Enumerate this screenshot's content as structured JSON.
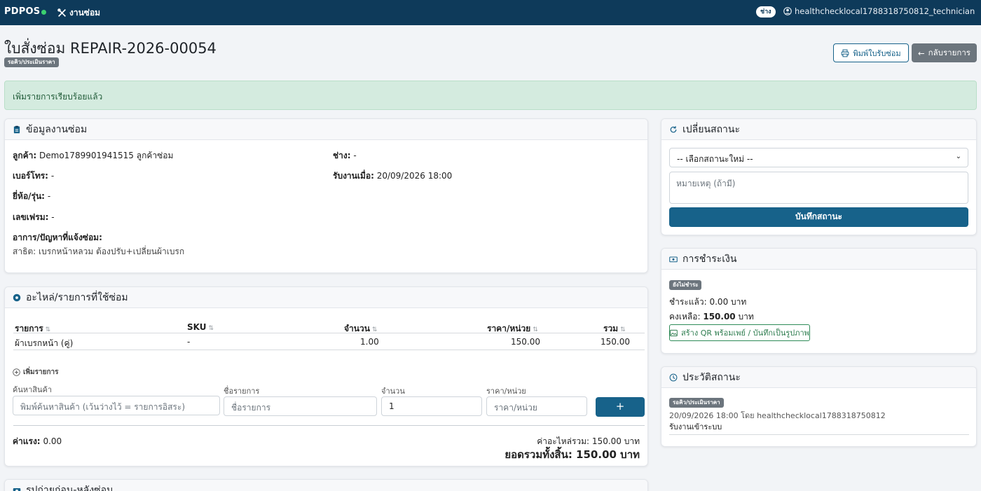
{
  "nav": {
    "brand": "PDPOS",
    "link_label": "งานซ่อม",
    "role_badge": "ช่าง",
    "user": "healthchecklocal1788318750812_technician"
  },
  "header": {
    "title": "ใบสั่งซ่อม REPAIR-2026-00054",
    "status": "รอคิว/ประเมินราคา",
    "print_label": "พิมพ์ใบรับซ่อม",
    "back_label": "กลับรายการ"
  },
  "alert": "เพิ่มรายการเรียบร้อยแล้ว",
  "job_info": {
    "title": "ข้อมูลงานซ่อม",
    "customer_label": "ลูกค้า:",
    "customer_value": "Demo1789901941515 ลูกค้าซ่อม",
    "phone_label": "เบอร์โทร:",
    "phone_value": "-",
    "brand_label": "ยี่ห้อ/รุ่น:",
    "brand_value": "-",
    "frame_label": "เลขเฟรม:",
    "frame_value": "-",
    "issue_label": "อาการ/ปัญหาที่แจ้งซ่อม:",
    "issue_value": "สาธิต: เบรกหน้าหลวม ต้องปรับ+เปลี่ยนผ้าเบรก",
    "tech_label": "ช่าง:",
    "tech_value": "-",
    "received_label": "รับงานเมื่อ:",
    "received_value": "20/09/2026 18:00"
  },
  "parts": {
    "title": "อะไหล่/รายการที่ใช้ซ่อม",
    "columns": [
      "รายการ",
      "SKU",
      "จำนวน",
      "ราคา/หน่วย",
      "รวม"
    ],
    "rows": [
      {
        "item": "ผ้าเบรกหน้า (คู่)",
        "sku": "-",
        "qty": "1.00",
        "price": "150.00",
        "total": "150.00"
      }
    ],
    "add_label": "เพิ่มรายการ",
    "search_label": "ค้นหาสินค้า",
    "search_placeholder": "พิมพ์ค้นหาสินค้า (เว้นว่างไว้ = รายการอิสระ)",
    "name_label": "ชื่อรายการ",
    "name_placeholder": "ชื่อรายการ",
    "qty_label": "จำนวน",
    "qty_value": "1",
    "price_label": "ราคา/หน่วย",
    "price_placeholder": "ราคา/หน่วย",
    "add_button": "+",
    "labor_label": "ค่าแรง:",
    "labor_value": "0.00",
    "parts_total": "ค่าอะไหล่รวม: 150.00 บาท",
    "grand_total": "ยอดรวมทั้งสิ้น: 150.00 บาท"
  },
  "photos_title": "รูปถ่ายก่อน-หลังซ่อม",
  "status_change": {
    "title": "เปลี่ยนสถานะ",
    "select_value": "-- เลือกสถานะใหม่ --",
    "note_placeholder": "หมายเหตุ (ถ้ามี)",
    "save_label": "บันทึกสถานะ"
  },
  "payment": {
    "title": "การชำระเงิน",
    "badge": "ยังไม่ชำระ",
    "paid_label": "ชำระแล้ว:",
    "paid_value": "0.00 บาท",
    "remaining_label": "คงเหลือ:",
    "remaining_value": "150.00",
    "remaining_unit": "บาท",
    "qr_button": "สร้าง QR พร้อมเพย์ / บันทึกเป็นรูปภาพ"
  },
  "history": {
    "title": "ประวัติสถานะ",
    "entries": [
      {
        "status": "รอคิว/ประเมินราคา",
        "meta": "20/09/2026 18:00 โดย healthchecklocal1788318750812",
        "note": "รับงานเข้าระบบ"
      }
    ]
  },
  "colors": {
    "navbar": "#0e3a5a",
    "primary": "#17628a",
    "success_bg": "#d4ebdf",
    "secondary": "#6c757d"
  }
}
